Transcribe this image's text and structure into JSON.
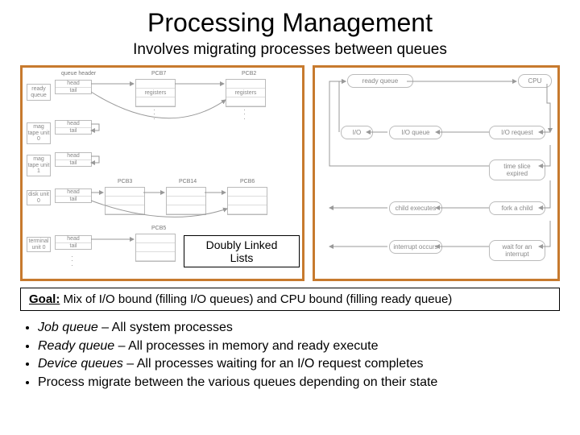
{
  "title": "Processing Management",
  "subtitle": "Involves migrating  processes between queues",
  "left_diagram": {
    "header_queue": "queue header",
    "queues": [
      "ready queue",
      "mag tape unit 0",
      "mag tape unit 1",
      "disk unit 0",
      "terminal unit 0"
    ],
    "queue_fields": [
      "head",
      "tail"
    ],
    "pcbs": [
      "PCB7",
      "PCB2",
      "PCB3",
      "PCB14",
      "PCB6",
      "PCB5"
    ],
    "pcb_field": "registers",
    "callout": "Doubly Linked Lists"
  },
  "right_diagram": {
    "nodes": [
      "ready queue",
      "CPU",
      "I/O",
      "I/O queue",
      "I/O request",
      "time slice expired",
      "child executes",
      "fork a child",
      "interrupt occurs",
      "wait for an interrupt"
    ]
  },
  "goal": {
    "label": "Goal:",
    "text": "Mix of I/O bound (filling I/O queues) and CPU bound (filling ready queue)"
  },
  "bullets": [
    {
      "term": "Job queue",
      "desc": " – All system processes"
    },
    {
      "term": "Ready queue",
      "desc": " – All processes in memory and ready execute"
    },
    {
      "term": "Device queues",
      "desc": " – All processes waiting for an I/O request completes"
    },
    {
      "term": "",
      "desc": "Process migrate between the various queues depending on their state"
    }
  ]
}
